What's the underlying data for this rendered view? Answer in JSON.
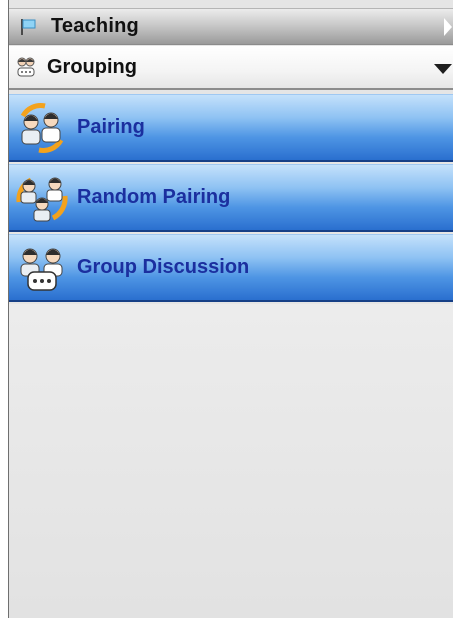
{
  "section": {
    "title": "Teaching",
    "icon": "flag-icon"
  },
  "group": {
    "title": "Grouping",
    "icon": "students-icon"
  },
  "items": [
    {
      "label": "Pairing",
      "icon": "pairing-icon"
    },
    {
      "label": "Random Pairing",
      "icon": "random-pairing-icon"
    },
    {
      "label": "Group Discussion",
      "icon": "group-discussion-icon"
    }
  ],
  "colors": {
    "item_label": "#1b2f9f",
    "item_bg_top": "#c4e1fb",
    "item_bg_bottom": "#2a6fcf",
    "header_text": "#111111"
  }
}
